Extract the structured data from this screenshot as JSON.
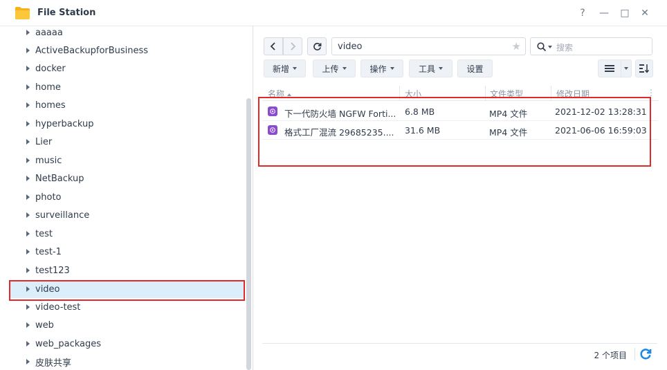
{
  "window": {
    "title": "File Station",
    "controls": [
      "?",
      "—",
      "□",
      "✕"
    ]
  },
  "sidebar": {
    "items": [
      {
        "label": "aaaaa"
      },
      {
        "label": "ActiveBackupforBusiness"
      },
      {
        "label": "docker"
      },
      {
        "label": "home"
      },
      {
        "label": "homes"
      },
      {
        "label": "hyperbackup"
      },
      {
        "label": "Lier"
      },
      {
        "label": "music"
      },
      {
        "label": "NetBackup"
      },
      {
        "label": "photo"
      },
      {
        "label": "surveillance"
      },
      {
        "label": "test"
      },
      {
        "label": "test-1"
      },
      {
        "label": "test123"
      },
      {
        "label": "video",
        "selected": true
      },
      {
        "label": "video-test"
      },
      {
        "label": "web"
      },
      {
        "label": "web_packages"
      },
      {
        "label": "皮肤共享"
      }
    ]
  },
  "path": {
    "value": "video"
  },
  "search": {
    "placeholder": "搜索"
  },
  "toolbar": {
    "new_label": "新增",
    "upload_label": "上传",
    "action_label": "操作",
    "tools_label": "工具",
    "settings_label": "设置"
  },
  "table": {
    "columns": [
      "名称",
      "大小",
      "文件类型",
      "修改日期"
    ],
    "rows": [
      {
        "name": "下一代防火墙 NGFW Forti...",
        "size": "6.8 MB",
        "type": "MP4 文件",
        "modified": "2021-12-02 13:28:31"
      },
      {
        "name": "格式工厂混流 29685235....",
        "size": "31.6 MB",
        "type": "MP4 文件",
        "modified": "2021-06-06 16:59:03"
      }
    ]
  },
  "status": {
    "count": "2 个项目"
  },
  "colors": {
    "accent": "#1e88e5",
    "selection": "#ddeefb",
    "highlight_box": "#e02a2a",
    "video_icon": "#8a4bd0",
    "folder": "#f7b21b"
  }
}
